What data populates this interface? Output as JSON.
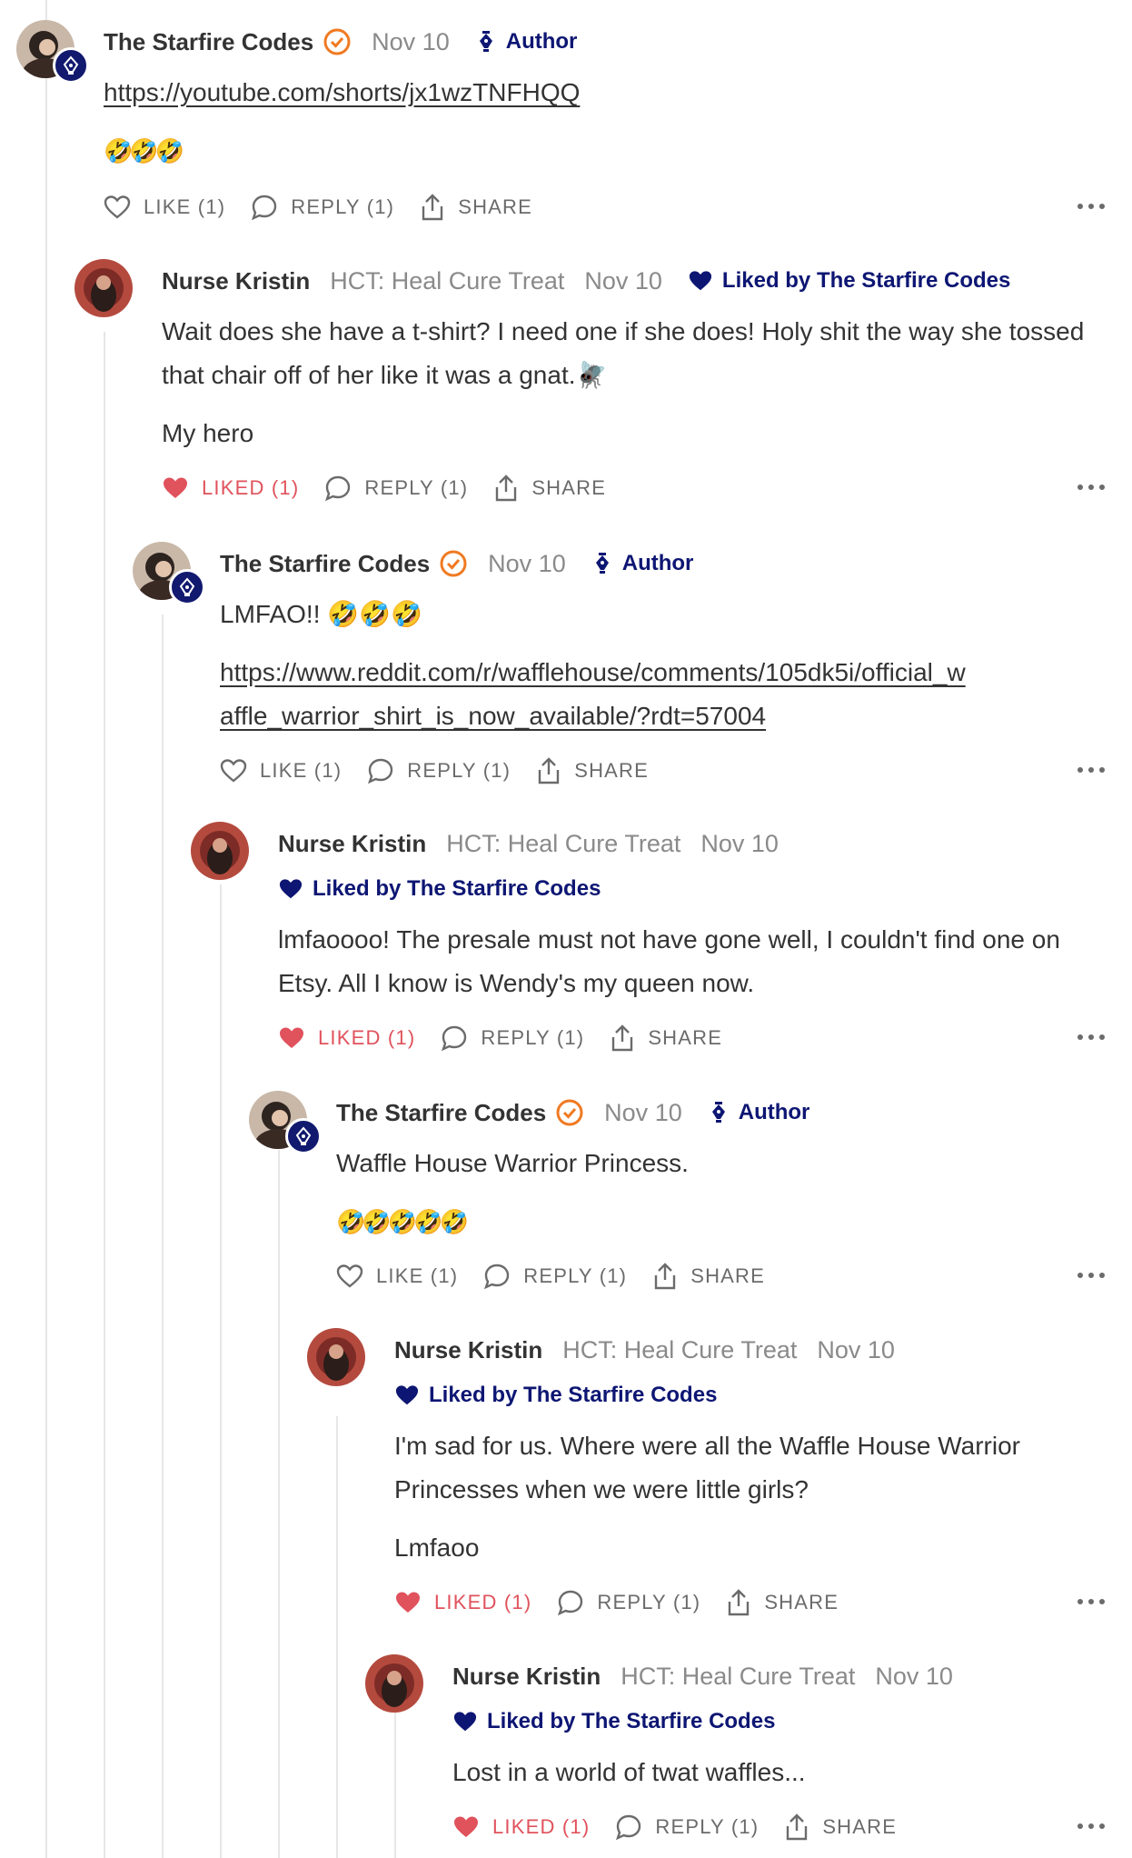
{
  "comments": [
    {
      "author": "The Starfire Codes",
      "date": "Nov 10",
      "role": "Author",
      "link1": "https://youtube.com/shorts/jx1wzTNFHQQ",
      "emojis": "🤣🤣🤣",
      "like": "LIKE (1)",
      "reply": "REPLY (1)",
      "share": "SHARE"
    },
    {
      "author": "Nurse Kristin",
      "community": "HCT: Heal Cure Treat",
      "date": "Nov 10",
      "liked_by": "Liked by The Starfire Codes",
      "text1": "Wait does she have a t-shirt? I need one if she does! Holy shit the way she tossed that chair off of her like it was a gnat.🪰",
      "text2": "My hero",
      "like": "LIKED (1)",
      "reply": "REPLY (1)",
      "share": "SHARE"
    },
    {
      "author": "The Starfire Codes",
      "date": "Nov 10",
      "role": "Author",
      "text1": "LMFAO!! 🤣🤣🤣",
      "link1": "https://www.reddit.com/r/wafflehouse/comments/105dk5i/official_waffle_warrior_shirt_is_now_available/?rdt=57004",
      "like": "LIKE (1)",
      "reply": "REPLY (1)",
      "share": "SHARE"
    },
    {
      "author": "Nurse Kristin",
      "community": "HCT: Heal Cure Treat",
      "date": "Nov 10",
      "liked_by": "Liked by The Starfire Codes",
      "text1": "lmfaoooo! The presale must not have gone well, I couldn't find one on Etsy. All I know is Wendy's my queen now.",
      "like": "LIKED (1)",
      "reply": "REPLY (1)",
      "share": "SHARE"
    },
    {
      "author": "The Starfire Codes",
      "date": "Nov 10",
      "role": "Author",
      "text1": "Waffle House Warrior Princess.",
      "emojis": "🤣🤣🤣🤣🤣",
      "like": "LIKE (1)",
      "reply": "REPLY (1)",
      "share": "SHARE"
    },
    {
      "author": "Nurse Kristin",
      "community": "HCT: Heal Cure Treat",
      "date": "Nov 10",
      "liked_by": "Liked by The Starfire Codes",
      "text1": "I'm sad for us. Where were all the Waffle House Warrior Princesses when we were little girls?",
      "text2": "Lmfaoo",
      "like": "LIKED (1)",
      "reply": "REPLY (1)",
      "share": "SHARE"
    },
    {
      "author": "Nurse Kristin",
      "community": "HCT: Heal Cure Treat",
      "date": "Nov 10",
      "liked_by": "Liked by The Starfire Codes",
      "text1": "Lost in a world of twat waffles...",
      "like": "LIKED (1)",
      "reply": "REPLY (1)",
      "share": "SHARE"
    }
  ],
  "colors": {
    "accent": "#0d1673",
    "liked": "#e0525c",
    "muted": "#8a8a8a",
    "check": "#f07a22"
  }
}
